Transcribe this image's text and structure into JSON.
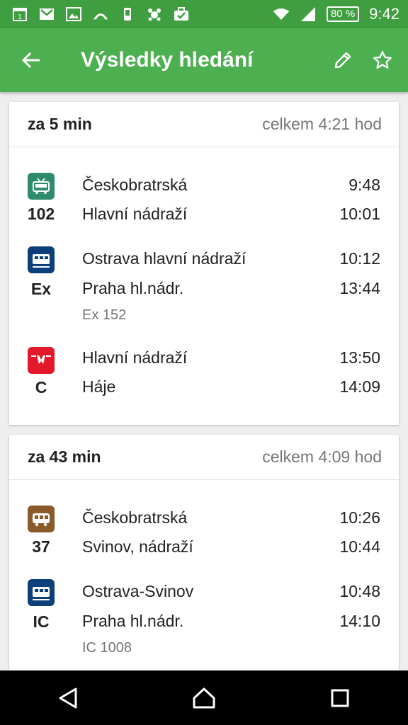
{
  "status_bar": {
    "calendar_day": "1",
    "battery": "80 %",
    "time": "9:42"
  },
  "app_bar": {
    "title": "Výsledky hledání"
  },
  "results": [
    {
      "departs_in": "za 5 min",
      "total": "celkem 4:21 hod",
      "legs": [
        {
          "type": "trolleybus",
          "color": "#2e8b6e",
          "line": "102",
          "from": "Českobratrská",
          "dep": "9:48",
          "to": "Hlavní nádraží",
          "arr": "10:01"
        },
        {
          "type": "train",
          "color": "#0d3f7a",
          "line": "Ex",
          "from": "Ostrava hlavní nádraží",
          "dep": "10:12",
          "to": "Praha hl.nádr.",
          "arr": "13:44",
          "note": "Ex 152"
        },
        {
          "type": "metro",
          "color": "#e3192b",
          "line": "C",
          "from": "Hlavní nádraží",
          "dep": "13:50",
          "to": "Háje",
          "arr": "14:09"
        }
      ]
    },
    {
      "departs_in": "za 43 min",
      "total": "celkem 4:09 hod",
      "legs": [
        {
          "type": "bus",
          "color": "#8b5a2b",
          "line": "37",
          "from": "Českobratrská",
          "dep": "10:26",
          "to": "Svinov, nádraží",
          "arr": "10:44"
        },
        {
          "type": "train",
          "color": "#0d3f7a",
          "line": "IC",
          "from": "Ostrava-Svinov",
          "dep": "10:48",
          "to": "Praha hl.nádr.",
          "arr": "14:10",
          "note": "IC 1008"
        }
      ]
    }
  ]
}
